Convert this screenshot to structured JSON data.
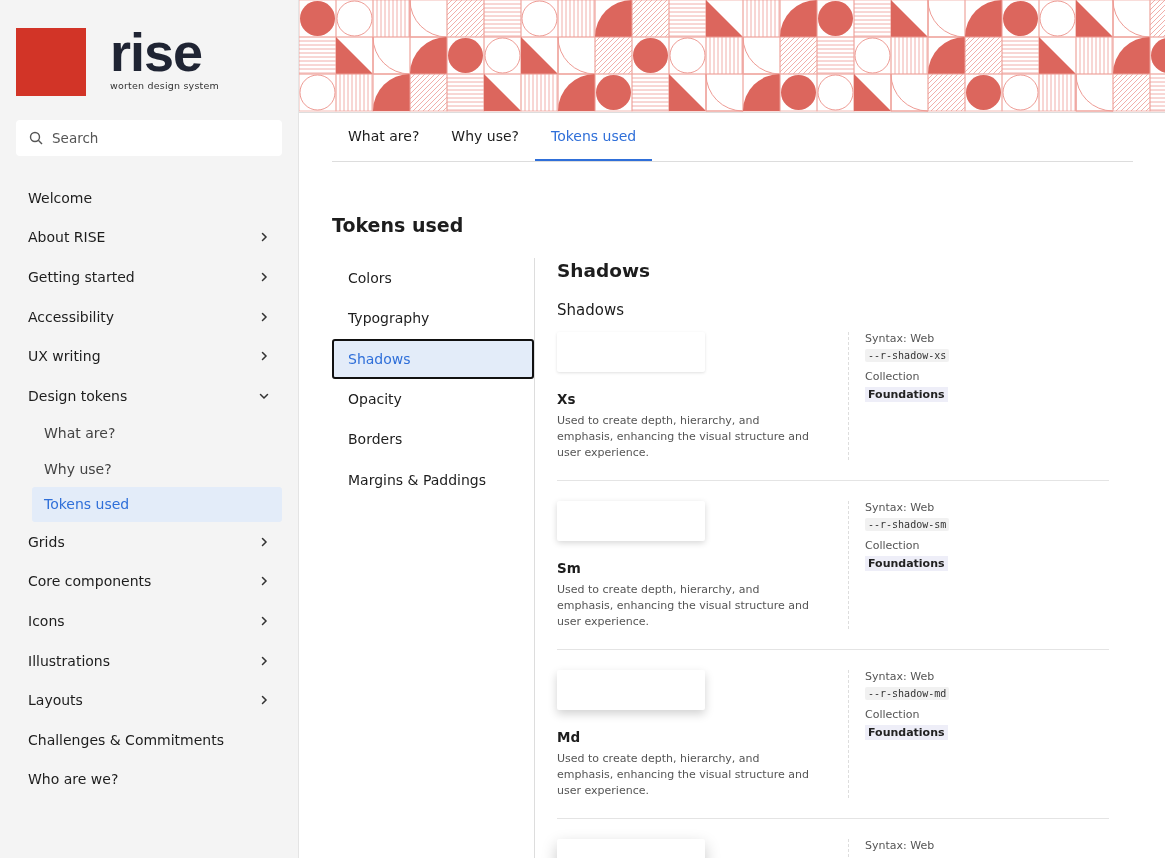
{
  "logo": {
    "wordmark": "rise",
    "tagline": "worten design system"
  },
  "search": {
    "placeholder": "Search"
  },
  "sidebar": {
    "items": [
      {
        "label": "Welcome",
        "selected": false
      },
      {
        "label": "About RISE",
        "selected": false,
        "expanded": false
      },
      {
        "label": "Getting started",
        "selected": false,
        "expanded": false
      },
      {
        "label": "Accessibility",
        "selected": false,
        "expanded": false
      },
      {
        "label": "UX writing",
        "selected": false,
        "expanded": false
      },
      {
        "label": "Design tokens",
        "selected": false,
        "expanded": true,
        "children": [
          {
            "label": "What are?",
            "selected": false
          },
          {
            "label": "Why use?",
            "selected": false
          },
          {
            "label": "Tokens used",
            "selected": true
          }
        ]
      },
      {
        "label": "Grids",
        "selected": false,
        "expanded": false
      },
      {
        "label": "Core components",
        "selected": false,
        "expanded": false
      },
      {
        "label": "Icons",
        "selected": false,
        "expanded": false
      },
      {
        "label": "Illustrations",
        "selected": false,
        "expanded": false
      },
      {
        "label": "Layouts",
        "selected": false,
        "expanded": false
      },
      {
        "label": "Challenges & Commitments",
        "selected": false
      },
      {
        "label": "Who are we?",
        "selected": false
      }
    ]
  },
  "tabs": [
    {
      "label": "What are?",
      "selected": false
    },
    {
      "label": "Why use?",
      "selected": false
    },
    {
      "label": "Tokens used",
      "selected": true
    }
  ],
  "heading": "Tokens used",
  "subnav": [
    {
      "label": "Colors",
      "selected": false
    },
    {
      "label": "Typography",
      "selected": false
    },
    {
      "label": "Shadows",
      "selected": true
    },
    {
      "label": "Opacity",
      "selected": false
    },
    {
      "label": "Borders",
      "selected": false
    },
    {
      "label": "Margins & Paddings",
      "selected": false
    }
  ],
  "section": {
    "title": "Shadows",
    "subtitle": "Shadows",
    "tokens": [
      {
        "kind": "xs",
        "name": "Xs",
        "description": "Used to create depth, hierarchy, and emphasis, enhancing the visual structure and user experience.",
        "syntax_label": "Syntax: Web",
        "token": "--r-shadow-xs",
        "collection_label": "Collection",
        "collection": "Foundations"
      },
      {
        "kind": "sm",
        "name": "Sm",
        "description": "Used to create depth, hierarchy, and emphasis, enhancing the visual structure and user experience.",
        "syntax_label": "Syntax: Web",
        "token": "--r-shadow-sm",
        "collection_label": "Collection",
        "collection": "Foundations"
      },
      {
        "kind": "md",
        "name": "Md",
        "description": "Used to create depth, hierarchy, and emphasis, enhancing the visual structure and user experience.",
        "syntax_label": "Syntax: Web",
        "token": "--r-shadow-md",
        "collection_label": "Collection",
        "collection": "Foundations"
      },
      {
        "kind": "lg",
        "syntax_label": "Syntax: Web"
      }
    ]
  }
}
